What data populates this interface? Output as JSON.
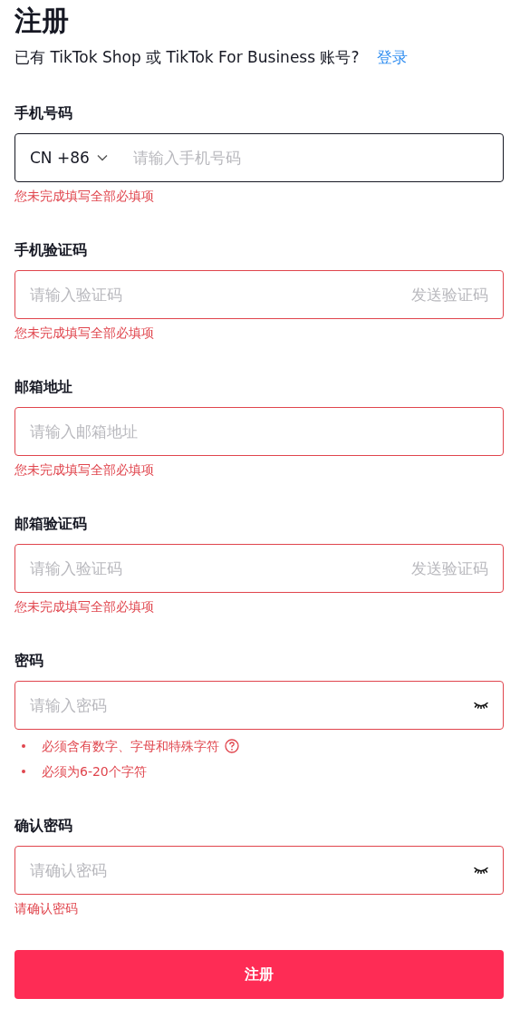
{
  "title": "注册",
  "login_prompt": {
    "text": "已有 TikTok Shop 或 TikTok For Business 账号?",
    "link": "登录"
  },
  "fields": [
    {
      "kind": "phone",
      "label": "手机号码",
      "country": "CN +86",
      "placeholder": "请输入手机号码",
      "invalid": false,
      "error": "您未完成填写全部必填项"
    },
    {
      "kind": "code",
      "label": "手机验证码",
      "placeholder": "请输入验证码",
      "action": "发送验证码",
      "invalid": true,
      "error": "您未完成填写全部必填项"
    },
    {
      "kind": "text",
      "label": "邮箱地址",
      "placeholder": "请输入邮箱地址",
      "invalid": true,
      "error": "您未完成填写全部必填项"
    },
    {
      "kind": "code",
      "label": "邮箱验证码",
      "placeholder": "请输入验证码",
      "action": "发送验证码",
      "invalid": true,
      "error": "您未完成填写全部必填项"
    },
    {
      "kind": "password",
      "label": "密码",
      "placeholder": "请输入密码",
      "invalid": true,
      "rules": [
        {
          "text": "必须含有数字、字母和特殊字符",
          "help": true
        },
        {
          "text": "必须为6-20个字符",
          "help": false
        }
      ]
    },
    {
      "kind": "password",
      "label": "确认密码",
      "placeholder": "请确认密码",
      "invalid": true,
      "error": "请确认密码"
    }
  ],
  "submit": "注册"
}
